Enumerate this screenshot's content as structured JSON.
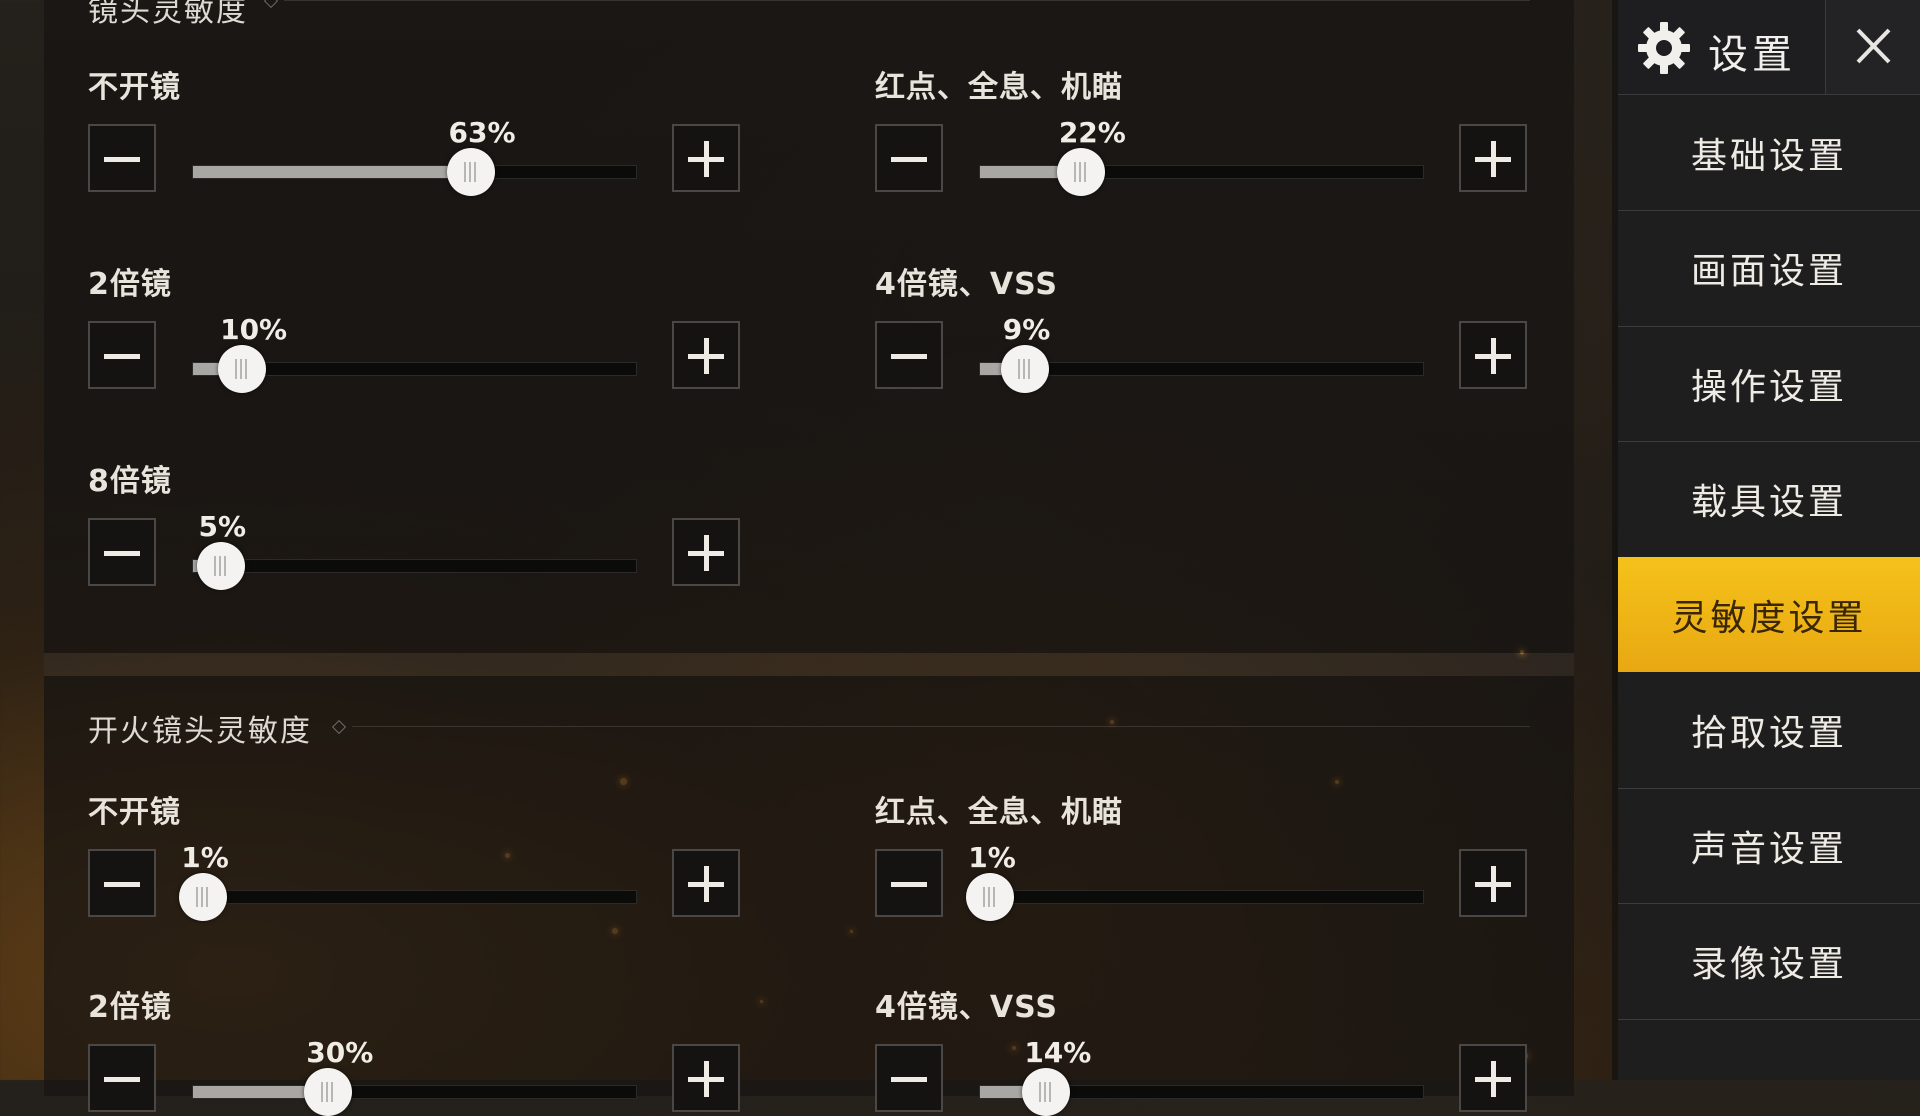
{
  "sections": [
    {
      "title": "镜头灵敏度",
      "rows": [
        {
          "label": "不开镜",
          "value_text": "63%",
          "value": 0.63
        },
        {
          "label": "红点、全息、机瞄",
          "value_text": "22%",
          "value": 0.22
        },
        {
          "label": "2倍镜",
          "value_text": "10%",
          "value": 0.1
        },
        {
          "label": "4倍镜、VSS",
          "value_text": "9%",
          "value": 0.09
        },
        {
          "label": "8倍镜",
          "value_text": "5%",
          "value": 0.05
        }
      ]
    },
    {
      "title": "开火镜头灵敏度",
      "rows": [
        {
          "label": "不开镜",
          "value_text": "1%",
          "value": 0.01
        },
        {
          "label": "红点、全息、机瞄",
          "value_text": "1%",
          "value": 0.01
        },
        {
          "label": "2倍镜",
          "value_text": "30%",
          "value": 0.3
        },
        {
          "label": "4倍镜、VSS",
          "value_text": "14%",
          "value": 0.14
        }
      ]
    }
  ],
  "sidebar": {
    "title": "设置",
    "items": [
      {
        "label": "基础设置",
        "active": false
      },
      {
        "label": "画面设置",
        "active": false
      },
      {
        "label": "操作设置",
        "active": false
      },
      {
        "label": "载具设置",
        "active": false
      },
      {
        "label": "灵敏度设置",
        "active": true
      },
      {
        "label": "拾取设置",
        "active": false
      },
      {
        "label": "声音设置",
        "active": false
      },
      {
        "label": "录像设置",
        "active": false
      }
    ]
  },
  "icons": {
    "settings": "gear-icon",
    "close": "close-icon",
    "decrease": "minus-icon",
    "increase": "plus-icon"
  },
  "colors": {
    "accent": "#F2B818",
    "slider_fill": "#A9A7A3",
    "knob": "#F4F3F1"
  }
}
